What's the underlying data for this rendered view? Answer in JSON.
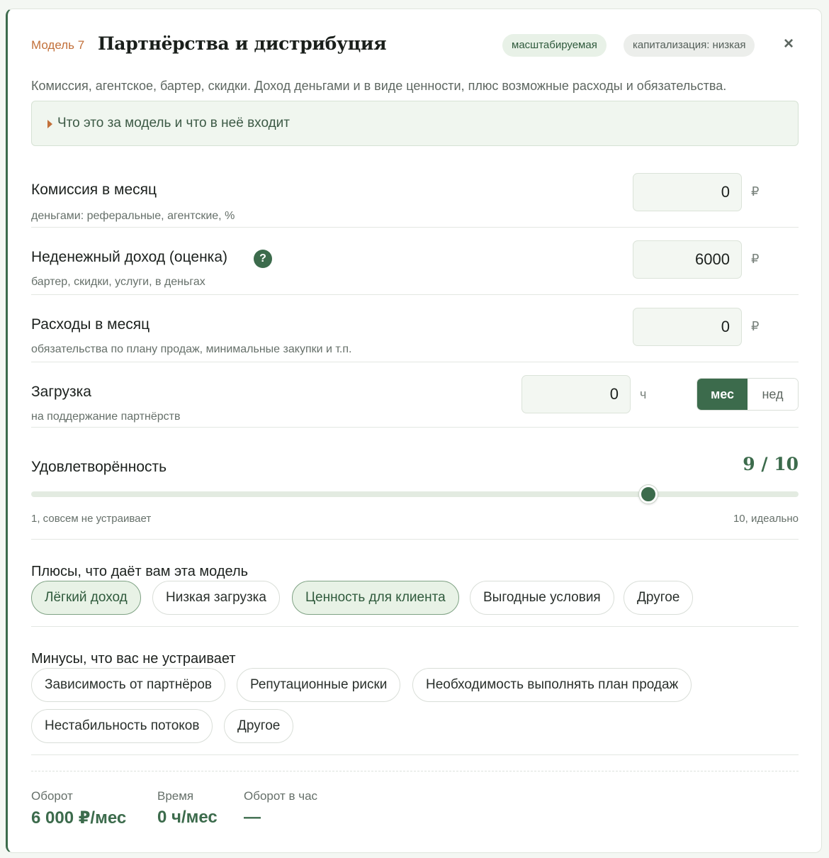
{
  "header": {
    "model_number": "Модель 7",
    "title": "Партнёрства и дистрибуция",
    "badges": [
      "масштабируемая",
      "капитализация: низкая"
    ],
    "close_icon": "×"
  },
  "description": "Комиссия, агентское, бартер, скидки. Доход деньгами и в виде ценности, плюс возможные расходы и обязательства.",
  "details_toggle": "Что это за модель и что в неё входит",
  "fields": [
    {
      "label": "Комиссия в месяц",
      "sublabel": "деньгами: реферальные, агентские, %",
      "value": "0",
      "unit": "₽"
    },
    {
      "label": "Неденежный доход (оценка)",
      "sublabel": "бартер, скидки, услуги, в деньгах",
      "value": "6000",
      "unit": "₽",
      "help": "?"
    },
    {
      "label": "Расходы в месяц",
      "sublabel": "обязательства по плану продаж, минимальные закупки и т.п.",
      "value": "0",
      "unit": "₽"
    },
    {
      "label": "Загрузка",
      "sublabel": "на поддержание партнёрств",
      "value": "0",
      "unit": "ч"
    }
  ],
  "period_toggle": {
    "options": [
      "мес",
      "нед"
    ],
    "selected": "мес"
  },
  "satisfaction": {
    "label": "Удовлетворённость",
    "value_text": "9 / 10",
    "value": 9,
    "min": 1,
    "max": 10,
    "min_label": "1, совсем не устраивает",
    "max_label": "10, идеально"
  },
  "pros": {
    "title": "Плюсы, что даёт вам эта модель",
    "chips": [
      {
        "label": "Лёгкий доход",
        "selected": true
      },
      {
        "label": "Низкая загрузка",
        "selected": false
      },
      {
        "label": "Ценность для клиента",
        "selected": true
      },
      {
        "label": "Выгодные условия",
        "selected": false
      },
      {
        "label": "Другое",
        "selected": false
      }
    ]
  },
  "cons": {
    "title": "Минусы, что вас не устраивает",
    "chips": [
      {
        "label": "Зависимость от партнёров",
        "selected": false
      },
      {
        "label": "Репутационные риски",
        "selected": false
      },
      {
        "label": "Необходимость выполнять план продаж",
        "selected": false
      },
      {
        "label": "Нестабильность потоков",
        "selected": false
      },
      {
        "label": "Другое",
        "selected": false
      }
    ]
  },
  "summary": [
    {
      "label": "Оборот",
      "value": "6 000 ₽/мес"
    },
    {
      "label": "Время",
      "value": "0 ч/мес"
    },
    {
      "label": "Оборот в час",
      "value": "—"
    }
  ],
  "colors": {
    "accent": "#3c6b4c",
    "model_number": "#c2703a",
    "chip_selected_bg": "#e8f2e6"
  }
}
